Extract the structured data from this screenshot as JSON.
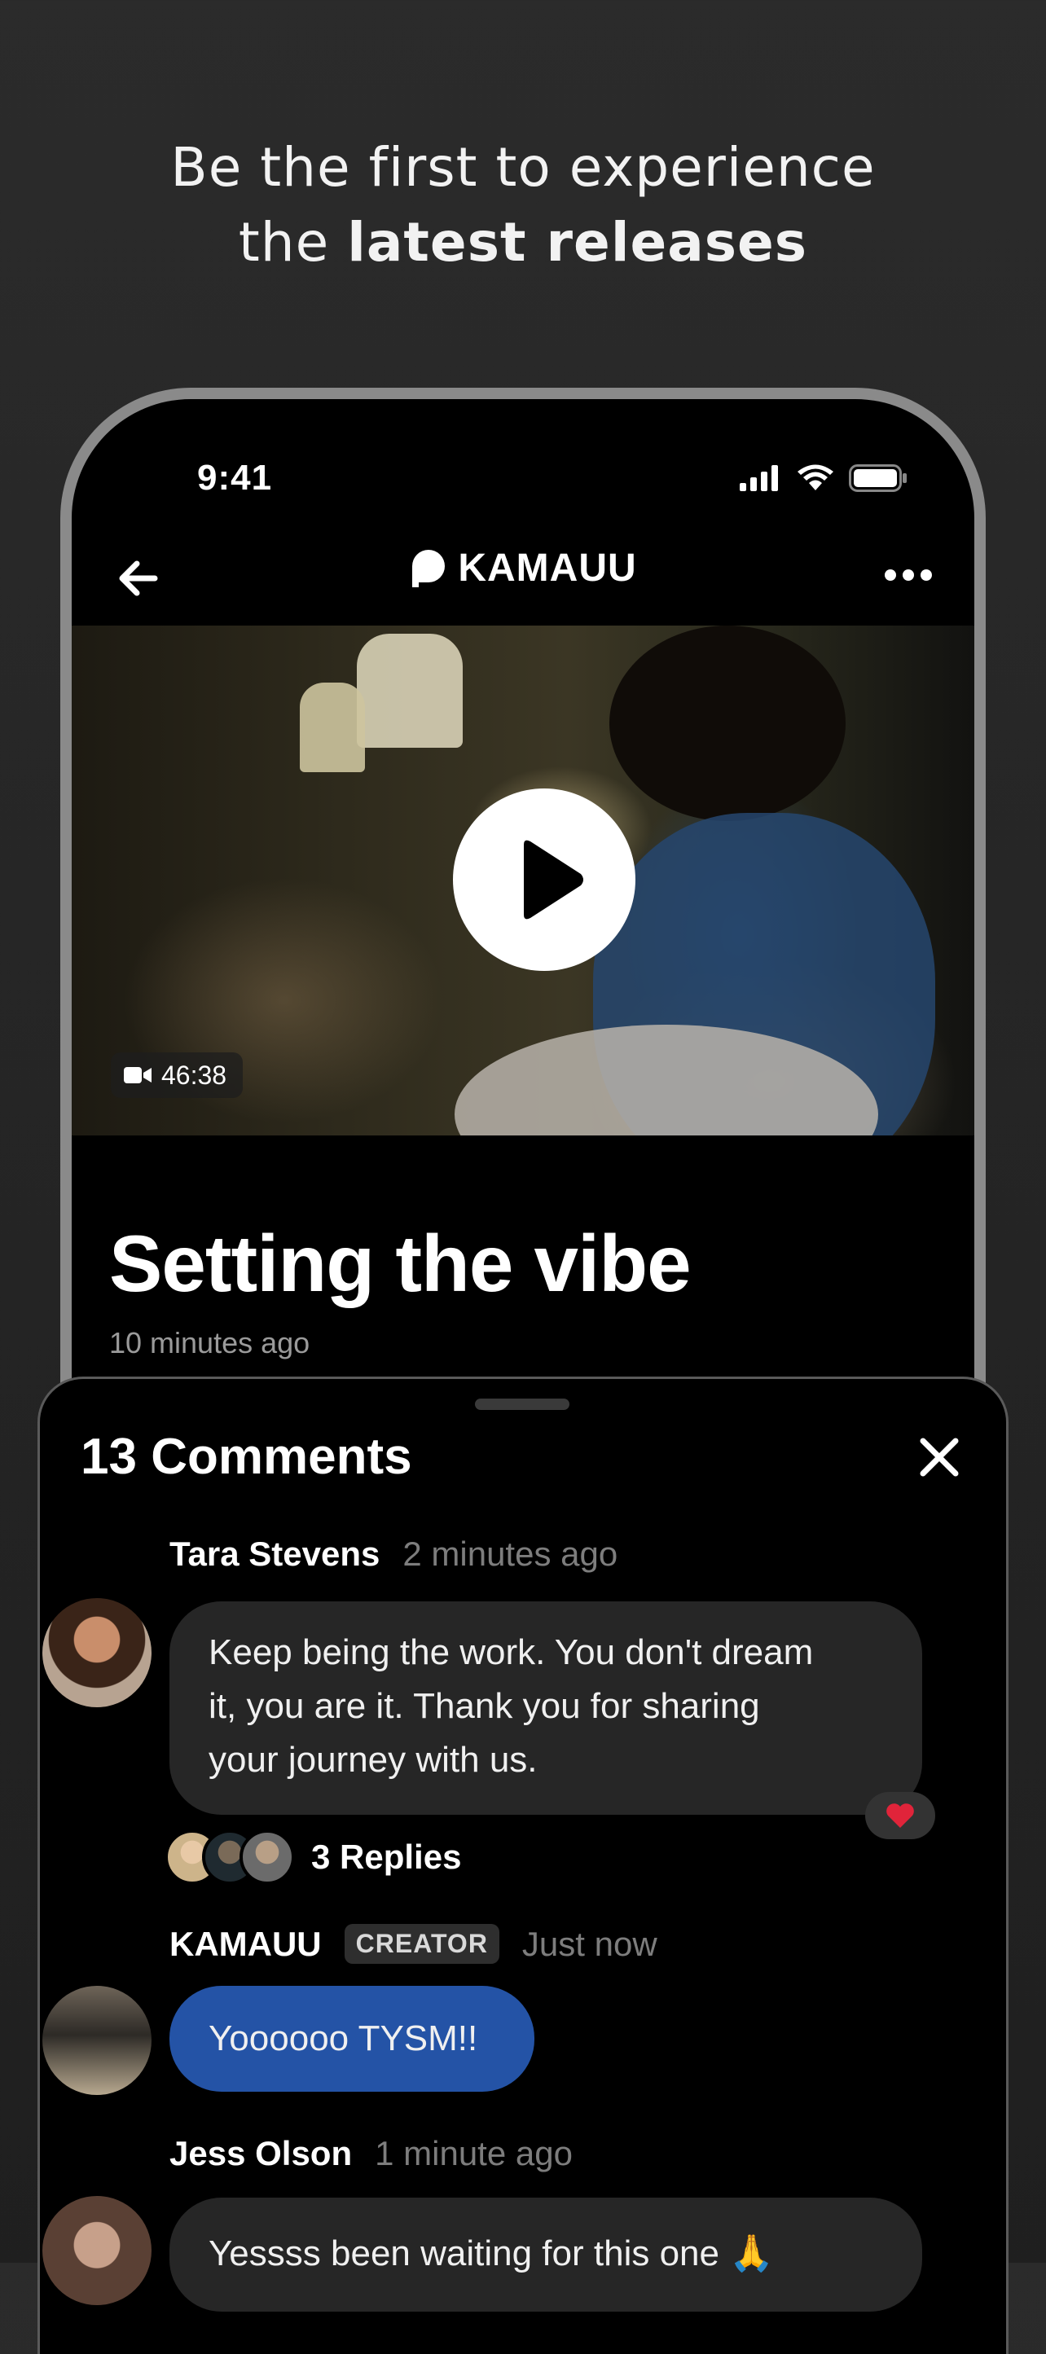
{
  "headline": {
    "line1": "Be the first to experience",
    "line2_prefix": "the ",
    "line2_bold": "latest releases"
  },
  "status_bar": {
    "time": "9:41",
    "icons": [
      "signal-icon",
      "wifi-icon",
      "battery-icon"
    ]
  },
  "nav": {
    "back_icon": "arrow-left-icon",
    "brand": "KAMAUU",
    "brand_icon": "patreon-logo-icon",
    "more_icon": "more-horizontal-icon"
  },
  "video": {
    "duration": "46:38",
    "play_icon": "play-icon",
    "camera_icon": "video-camera-icon"
  },
  "post": {
    "title": "Setting the vibe",
    "time": "10 minutes ago"
  },
  "comments_sheet": {
    "title": "13 Comments",
    "close_icon": "close-icon",
    "comments": [
      {
        "author": "Tara Stevens",
        "time": "2 minutes ago",
        "text_lines": [
          "Keep being the work. You don't dream",
          "it, you are it. Thank you for sharing",
          "your journey with us."
        ],
        "reaction": "❤️",
        "replies_label": "3 Replies"
      },
      {
        "author": "KAMAUU",
        "badge": "CREATOR",
        "time": "Just now",
        "text": "Yoooooo TYSM!!"
      },
      {
        "author": "Jess Olson",
        "time": "1 minute ago",
        "text": "Yessss been waiting for this one 🙏"
      }
    ]
  },
  "colors": {
    "background": "#262626",
    "accent_blue": "#2453a6",
    "bubble_gray": "#262626",
    "muted_text": "#7d7d7d"
  }
}
